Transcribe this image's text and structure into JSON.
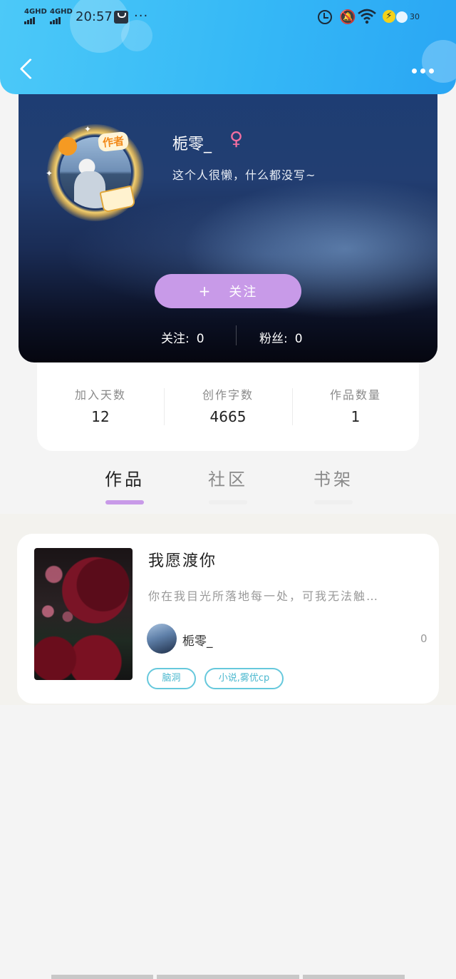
{
  "status_bar": {
    "signal_1": "4GHD",
    "signal_2": "4GHD",
    "time": "20:57",
    "more": "···",
    "battery_level": "30"
  },
  "header": {
    "back_icon": "chevron-left-icon",
    "more_icon": "more-horizontal-icon"
  },
  "profile": {
    "username": "栀零_",
    "gender_symbol": "♀",
    "bio": "这个人很懒，什么都没写~",
    "author_badge": "作者",
    "follow_button": {
      "plus": "+",
      "label": "关注"
    },
    "following": {
      "label": "关注:",
      "value": "0"
    },
    "followers": {
      "label": "粉丝:",
      "value": "0"
    }
  },
  "stats": [
    {
      "label": "加入天数",
      "value": "12"
    },
    {
      "label": "创作字数",
      "value": "4665"
    },
    {
      "label": "作品数量",
      "value": "1"
    }
  ],
  "tabs": [
    {
      "label": "作品",
      "active": true
    },
    {
      "label": "社区",
      "active": false
    },
    {
      "label": "书架",
      "active": false
    }
  ],
  "works": [
    {
      "title": "我愿渡你",
      "description": "你在我目光所落地每一处，可我无法触…",
      "author": "栀零_",
      "count": "0",
      "tags": [
        "脑洞",
        "小说,雾优cp"
      ]
    }
  ],
  "colors": {
    "header_blue": "#35b8f6",
    "accent_purple": "#c89ae8",
    "tag_teal": "#4bb8cf",
    "gender_pink": "#f36fa1"
  }
}
